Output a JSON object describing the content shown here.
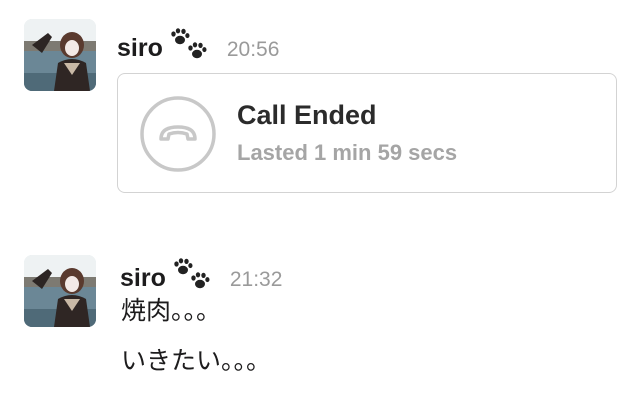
{
  "messages": [
    {
      "username": "siro",
      "badge_icon": "paw-prints-icon",
      "timestamp": "20:56",
      "call": {
        "icon": "phone-hangup-icon",
        "title": "Call Ended",
        "subtitle": "Lasted 1 min 59 secs"
      }
    },
    {
      "username": "siro",
      "badge_icon": "paw-prints-icon",
      "timestamp": "21:32",
      "lines": [
        "焼肉。。。",
        "いきたい。。。"
      ]
    }
  ],
  "colors": {
    "text": "#1d1c1d",
    "timestamp": "#9a9a9a",
    "card_border": "#d3d3d3",
    "call_icon": "#c8c8c8",
    "subtitle": "#a5a5a5"
  }
}
